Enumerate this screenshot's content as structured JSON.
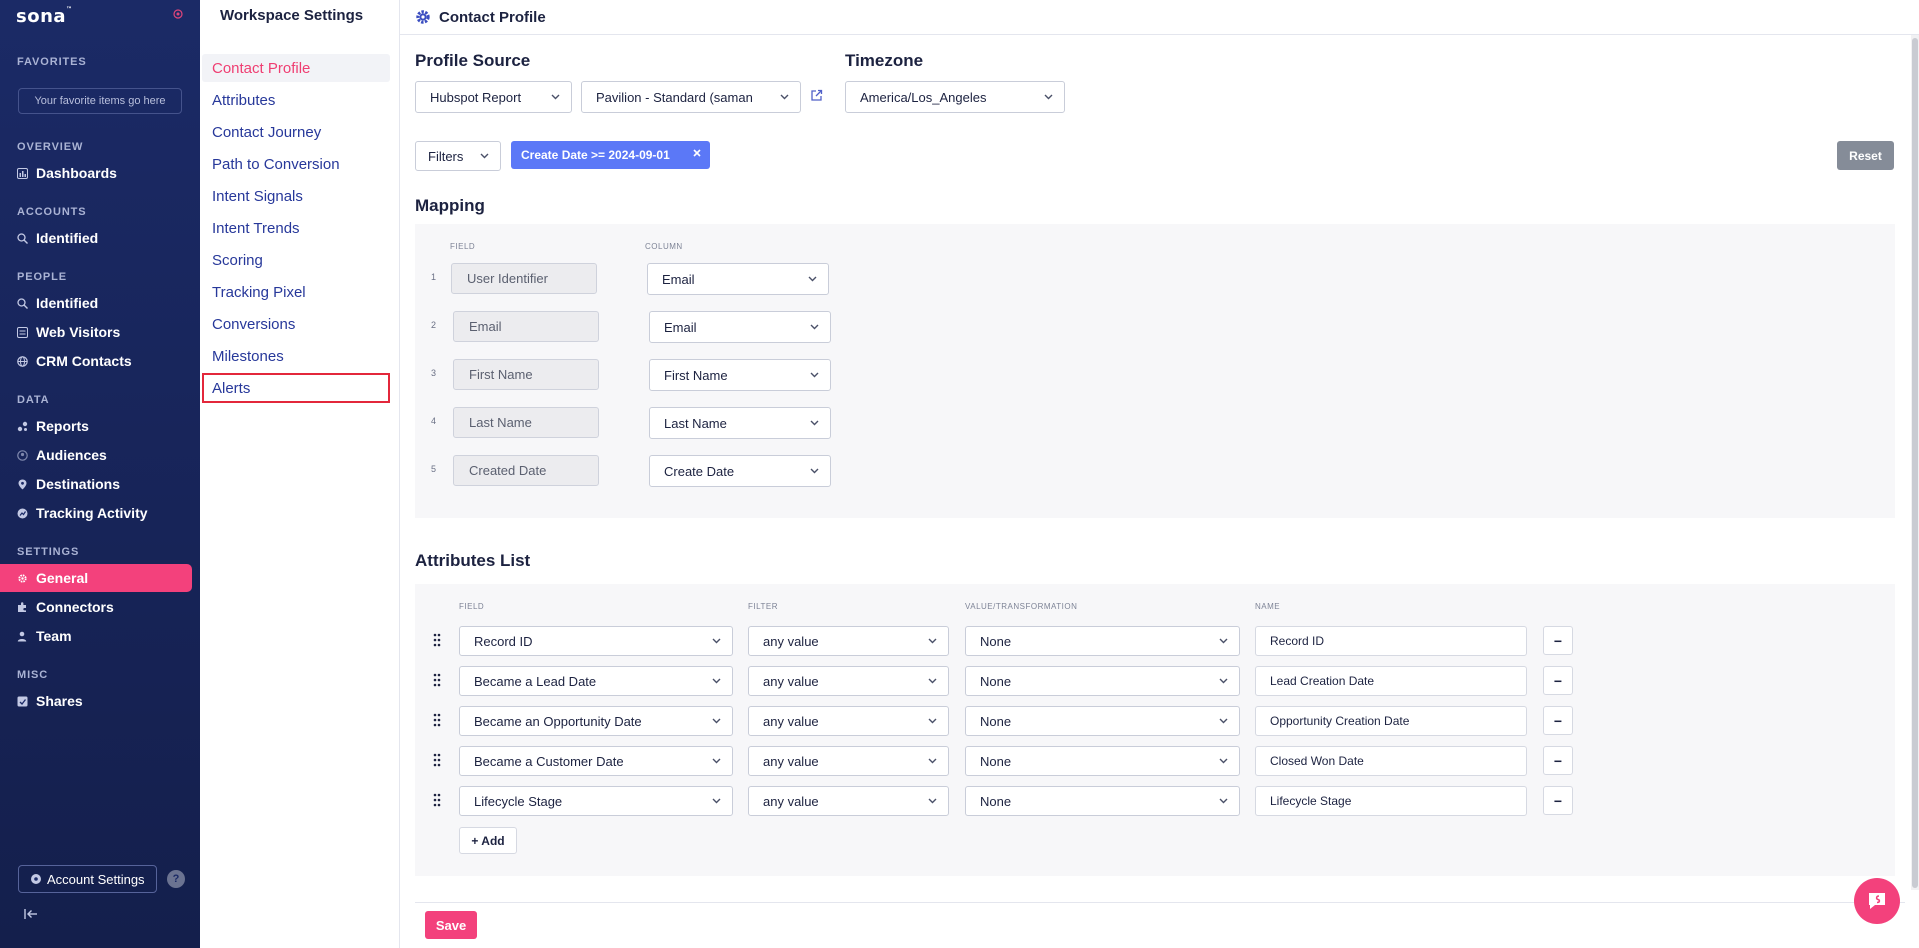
{
  "sidebar": {
    "logo": "sona",
    "logo_tm": "™",
    "favorites_section": "FAVORITES",
    "favorites_placeholder": "Your favorite items go here",
    "overview_section": "OVERVIEW",
    "dashboards": "Dashboards",
    "accounts_section": "ACCOUNTS",
    "accounts_identified": "Identified",
    "people_section": "PEOPLE",
    "people_identified": "Identified",
    "web_visitors": "Web Visitors",
    "crm_contacts": "CRM Contacts",
    "data_section": "DATA",
    "reports": "Reports",
    "audiences": "Audiences",
    "destinations": "Destinations",
    "tracking_activity": "Tracking Activity",
    "settings_section": "SETTINGS",
    "general": "General",
    "connectors": "Connectors",
    "team": "Team",
    "misc_section": "MISC",
    "shares": "Shares",
    "account_settings": "Account Settings",
    "help": "?"
  },
  "subnav": {
    "title": "Workspace Settings",
    "items": [
      "Contact Profile",
      "Attributes",
      "Contact Journey",
      "Path to Conversion",
      "Intent Signals",
      "Intent Trends",
      "Scoring",
      "Tracking Pixel",
      "Conversions",
      "Milestones",
      "Alerts"
    ]
  },
  "main": {
    "page_title": "Contact Profile",
    "profile_source_heading": "Profile Source",
    "profile_source_type": "Hubspot Report",
    "profile_source_report": "Pavilion - Standard (saman",
    "timezone_heading": "Timezone",
    "timezone_value": "America/Los_Angeles",
    "filters_label": "Filters",
    "filter_chip": "Create Date >= 2024-09-01",
    "reset_label": "Reset",
    "mapping_heading": "Mapping",
    "mapping_field_header": "FIELD",
    "mapping_column_header": "COLUMN",
    "mapping_rows": [
      {
        "num": "1",
        "field": "User Identifier",
        "column": "Email"
      },
      {
        "num": "2",
        "field": "Email",
        "column": "Email"
      },
      {
        "num": "3",
        "field": "First Name",
        "column": "First Name"
      },
      {
        "num": "4",
        "field": "Last Name",
        "column": "Last Name"
      },
      {
        "num": "5",
        "field": "Created Date",
        "column": "Create Date"
      }
    ],
    "attributes_heading": "Attributes List",
    "attr_field_header": "FIELD",
    "attr_filter_header": "FILTER",
    "attr_value_header": "VALUE/TRANSFORMATION",
    "attr_name_header": "NAME",
    "attribute_rows": [
      {
        "field": "Record ID",
        "filter": "any value",
        "value": "None",
        "name": "Record ID"
      },
      {
        "field": "Became a Lead Date",
        "filter": "any value",
        "value": "None",
        "name": "Lead Creation Date"
      },
      {
        "field": "Became an Opportunity Date",
        "filter": "any value",
        "value": "None",
        "name": "Opportunity Creation Date"
      },
      {
        "field": "Became a Customer Date",
        "filter": "any value",
        "value": "None",
        "name": "Closed Won Date"
      },
      {
        "field": "Lifecycle Stage",
        "filter": "any value",
        "value": "None",
        "name": "Lifecycle Stage"
      }
    ],
    "remove_label": "−",
    "add_label": "+ Add",
    "save_label": "Save"
  },
  "colors": {
    "sidebar_bg": "#1b2a66",
    "accent_pink": "#f3417c",
    "chip_blue": "#5b78f7",
    "link_blue": "#27389a",
    "alert_outline": "#e3273b"
  },
  "icons": [
    "gear-icon",
    "chart-icon",
    "search-icon",
    "list-icon",
    "globe-icon",
    "reports-icon",
    "audience-icon",
    "pin-icon",
    "activity-icon",
    "puzzle-icon",
    "team-icon",
    "share-icon",
    "chevron-down-icon",
    "external-link-icon",
    "close-icon",
    "drag-handle-icon",
    "collapse-icon",
    "chat-icon"
  ]
}
